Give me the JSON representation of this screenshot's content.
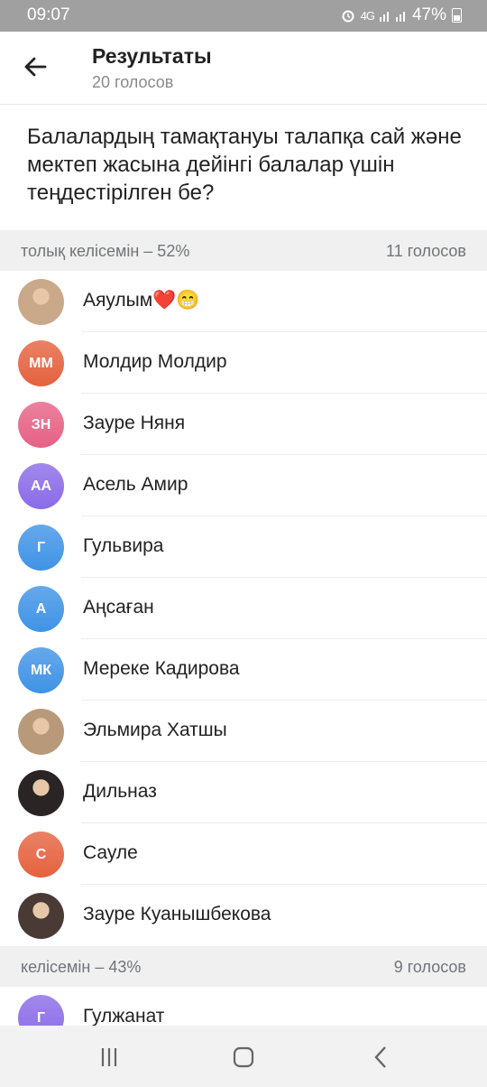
{
  "status": {
    "time": "09:07",
    "network": "4G",
    "battery": "47%"
  },
  "header": {
    "title": "Результаты",
    "subtitle": "20 голосов"
  },
  "question": "Балалардың тамақтануы талапқа сай және мектеп жасына дейінгі балалар үшін теңдестірілген бе?",
  "sections": [
    {
      "label": "толық келісемін – 52%",
      "count": "11 голосов",
      "voters": [
        {
          "name": "Аяулым❤️😁",
          "initials": "",
          "color": "#c9a98a",
          "photo": true
        },
        {
          "name": "Молдир Молдир",
          "initials": "ММ",
          "color": "#e5623f",
          "photo": false
        },
        {
          "name": "Зауре Няня",
          "initials": "ЗН",
          "color": "#e66185",
          "photo": false
        },
        {
          "name": "Асель Амир",
          "initials": "АА",
          "color": "#8a6be8",
          "photo": false
        },
        {
          "name": "Гульвира",
          "initials": "Г",
          "color": "#3f93e6",
          "photo": false
        },
        {
          "name": "Аңсаған",
          "initials": "А",
          "color": "#3f93e6",
          "photo": false
        },
        {
          "name": "Мереке Кадирова",
          "initials": "МК",
          "color": "#3f93e6",
          "photo": false
        },
        {
          "name": "Эльмира Хатшы",
          "initials": "",
          "color": "#b89a7a",
          "photo": true
        },
        {
          "name": "Дильназ",
          "initials": "",
          "color": "#2a2424",
          "photo": true
        },
        {
          "name": "Сауле",
          "initials": "С",
          "color": "#e5623f",
          "photo": false
        },
        {
          "name": "Зауре Куанышбекова",
          "initials": "",
          "color": "#4a3a36",
          "photo": true
        }
      ]
    },
    {
      "label": "келісемін – 43%",
      "count": "9 голосов",
      "voters": [
        {
          "name": "Гулжанат",
          "initials": "Г",
          "color": "#8a6be8",
          "photo": false
        }
      ]
    }
  ]
}
